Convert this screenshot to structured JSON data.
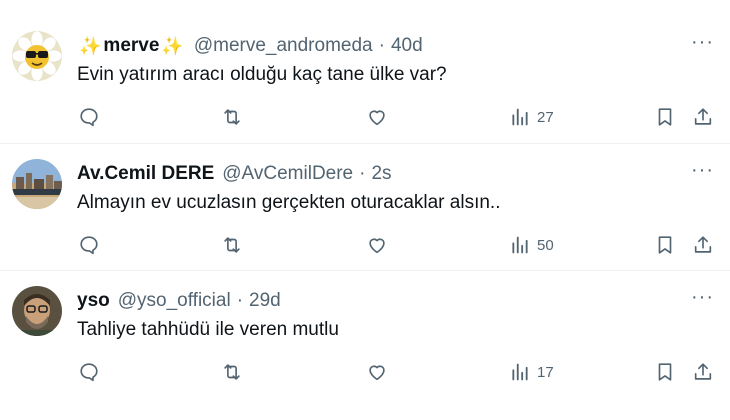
{
  "colors": {
    "text": "#0f1419",
    "muted": "#536471",
    "divider": "#eff3f4",
    "sparkle": "#f4b400"
  },
  "tweets": [
    {
      "name": "merve",
      "name_prefix_emoji": "✨",
      "name_suffix_emoji": "✨",
      "handle": "@merve_andromeda",
      "separator": "·",
      "time": "40d",
      "more": "···",
      "text": "Evin yatırım aracı olduğu kaç tane ülke var?",
      "views": "27",
      "avatar_icon": "daisy-with-sunglasses-avatar"
    },
    {
      "name": "Av.Cemil DERE",
      "handle": "@AvCemilDere",
      "separator": "·",
      "time": "2s",
      "more": "···",
      "text": "Almayın ev ucuzlasın gerçekten oturacaklar alsın..",
      "views": "50",
      "avatar_icon": "city-skyline-avatar"
    },
    {
      "name": "yso",
      "handle": "@yso_official",
      "separator": "·",
      "time": "29d",
      "more": "···",
      "text": "Tahliye tahhüdü ile veren mutlu",
      "views": "17",
      "avatar_icon": "bearded-man-avatar"
    }
  ]
}
